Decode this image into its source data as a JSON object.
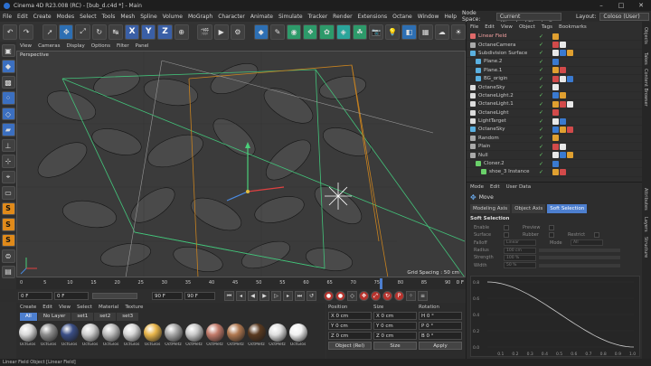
{
  "window": {
    "title": "Cinema 4D R23.008 (RC) - [bub_d.c4d *] - Main"
  },
  "menubar": {
    "items": [
      "File",
      "Edit",
      "Create",
      "Modes",
      "Select",
      "Tools",
      "Mesh",
      "Spline",
      "Volume",
      "MoGraph",
      "Character",
      "Animate",
      "Simulate",
      "Tracker",
      "Render",
      "Extensions",
      "Octane",
      "Window",
      "Help"
    ],
    "node_space_label": "Node Space:",
    "node_space_value": "Current (Standard/Physical)",
    "layout_label": "Layout:",
    "layout_value": "Coloso (User)"
  },
  "toolbar": {
    "axis_x": "X",
    "axis_y": "Y",
    "axis_z": "Z"
  },
  "viewport": {
    "menu": [
      "View",
      "Cameras",
      "Display",
      "Options",
      "Filter",
      "Panel"
    ],
    "label": "Perspective",
    "grid_spacing": "Grid Spacing : 50 cm"
  },
  "timeline": {
    "ticks": [
      "0",
      "5",
      "10",
      "15",
      "20",
      "25",
      "30",
      "35",
      "40",
      "45",
      "50",
      "55",
      "60",
      "65",
      "70",
      "75",
      "80",
      "85",
      "90"
    ],
    "end_frame": "0 F"
  },
  "playback": {
    "current": "0 F",
    "start": "0 F",
    "end": "90 F",
    "end2": "90 F"
  },
  "materials": {
    "menu": [
      "Create",
      "Edit",
      "View",
      "Select",
      "Material",
      "Texture"
    ],
    "tabs": [
      "All",
      "No Layer",
      "set1",
      "set2",
      "set3"
    ],
    "active_tab": "set3",
    "items": [
      {
        "label": "OctGlos",
        "color": "#d9d9d9"
      },
      {
        "label": "OctGlos",
        "color": "#8d8d8d"
      },
      {
        "label": "OctGlos",
        "color": "#3a4e86"
      },
      {
        "label": "OctGlos",
        "color": "#cfcfcf"
      },
      {
        "label": "OctGlos",
        "color": "#bdbdbd"
      },
      {
        "label": "OctGlos",
        "color": "#d7d7d7"
      },
      {
        "label": "OctGlos",
        "color": "#e8b54a"
      },
      {
        "label": "OctMetz",
        "color": "#a8a8a8"
      },
      {
        "label": "OctMetz",
        "color": "#c9c9c9"
      },
      {
        "label": "OctMetz",
        "color": "#c27a6a"
      },
      {
        "label": "OctMetz",
        "color": "#b07850"
      },
      {
        "label": "OctMetz",
        "color": "#5a3a20"
      },
      {
        "label": "OctMetz",
        "color": "#e0e0e0"
      },
      {
        "label": "OctGlos",
        "color": "#f2f2f2"
      }
    ]
  },
  "coords": {
    "headers": [
      "Position",
      "Size",
      "Rotation"
    ],
    "rows": [
      [
        "X",
        "0 cm",
        "X",
        "0 cm",
        "H",
        "0 °"
      ],
      [
        "Y",
        "0 cm",
        "Y",
        "0 cm",
        "P",
        "0 °"
      ],
      [
        "Z",
        "0 cm",
        "Z",
        "0 cm",
        "B",
        "0 °"
      ]
    ],
    "mode_select": "Object (Rel)",
    "size_select": "Size",
    "apply": "Apply"
  },
  "objects": {
    "menu": [
      "File",
      "Edit",
      "View",
      "Object",
      "Tags",
      "Bookmarks"
    ],
    "items": [
      {
        "name": "Linear Field",
        "color": "#e06a6a",
        "indent": 0,
        "highlight": true
      },
      {
        "name": "OctaneCamera",
        "color": "#aaaaaa",
        "indent": 0
      },
      {
        "name": "Subdivision Surface",
        "color": "#5ab0e0",
        "indent": 0
      },
      {
        "name": "Plane.2",
        "color": "#5ab0e0",
        "indent": 1
      },
      {
        "name": "Plane.1",
        "color": "#5ab0e0",
        "indent": 1
      },
      {
        "name": "BG_origin",
        "color": "#5ab0e0",
        "indent": 1
      },
      {
        "name": "OctaneSky",
        "color": "#dddddd",
        "indent": 0
      },
      {
        "name": "OctaneLight.2",
        "color": "#dddddd",
        "indent": 0
      },
      {
        "name": "OctaneLight.1",
        "color": "#dddddd",
        "indent": 0
      },
      {
        "name": "OctaneLight",
        "color": "#dddddd",
        "indent": 0
      },
      {
        "name": "LightTarget",
        "color": "#dddddd",
        "indent": 0
      },
      {
        "name": "OctaneSky",
        "color": "#5ab0e0",
        "indent": 0
      },
      {
        "name": "Random",
        "color": "#aaaaaa",
        "indent": 0
      },
      {
        "name": "Plain",
        "color": "#aaaaaa",
        "indent": 0
      },
      {
        "name": "Null",
        "color": "#aaaaaa",
        "indent": 0
      },
      {
        "name": "Cloner.2",
        "color": "#6ad06a",
        "indent": 1
      },
      {
        "name": "shoe_3 Instance",
        "color": "#6ad06a",
        "indent": 2
      }
    ]
  },
  "attributes": {
    "menu": [
      "Mode",
      "Edit",
      "User Data"
    ],
    "title": "Move",
    "tabs": [
      "Modeling Axis",
      "Object Axis",
      "Soft Selection"
    ],
    "active_tab": "Soft Selection",
    "section": "Soft Selection",
    "enable": "Enable",
    "preview": "Preview",
    "surface": "Surface",
    "rubber": "Rubber",
    "restrict": "Restrict",
    "falloff": "Falloff",
    "falloff_val": "Linear",
    "mode": "Mode",
    "mode_val": "All",
    "radius": "Radius",
    "radius_val": "100 cm",
    "strength": "Strength",
    "strength_val": "100 %",
    "width": "Width",
    "width_val": "50 %",
    "curve_ticks": [
      "0.8",
      "0.6",
      "0.4",
      "0.2",
      "0.0"
    ],
    "curve_xticks": [
      "0.1",
      "0.2",
      "0.3",
      "0.4",
      "0.5",
      "0.6",
      "0.7",
      "0.8",
      "0.9",
      "1.0"
    ]
  },
  "sidetabs": [
    "Objects",
    "Takes",
    "Content Browser",
    "Layers",
    "Structure"
  ],
  "sidetabs2": [
    "Attributes"
  ],
  "status": "Linear Field Object [Linear Field]"
}
